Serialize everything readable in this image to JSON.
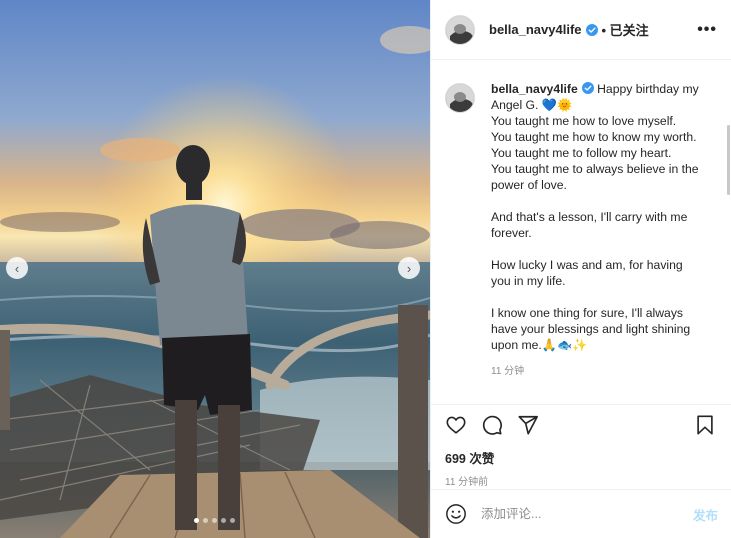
{
  "post": {
    "username": "bella_navy4life",
    "follow_label": "• 已关注",
    "more_label": "•••",
    "caption": {
      "line1": "Happy birthday my Angel G. 💙🌞",
      "paragraphs": [
        "You taught me how to love myself.\nYou taught me how to know my worth.\nYou taught me to follow my heart.\nYou taught me to always believe in the power of love.",
        "And that's a lesson, I'll carry with me forever.",
        "How lucky I was and am, for having you in my life.",
        "I know one thing for sure, I'll always have your blessings and light shining upon me.🙏🐟✨"
      ],
      "time": "11 分钟"
    },
    "likes": "699 次赞",
    "time_ago": "11 分钟前"
  },
  "comment": {
    "placeholder": "添加评论...",
    "post_label": "发布"
  },
  "carousel": {
    "prev_label": "‹",
    "next_label": "›",
    "slide_count": 5,
    "active_slide": 1
  },
  "icons": {
    "verified": "verified-badge-icon",
    "like": "heart-icon",
    "comment": "comment-bubble-icon",
    "share": "paper-plane-icon",
    "save": "bookmark-icon",
    "emoji": "emoji-smiley-icon"
  },
  "colors": {
    "verified_blue": "#3897f0",
    "post_button_disabled": "#b2dffc",
    "muted_text": "#8e8e8e"
  }
}
